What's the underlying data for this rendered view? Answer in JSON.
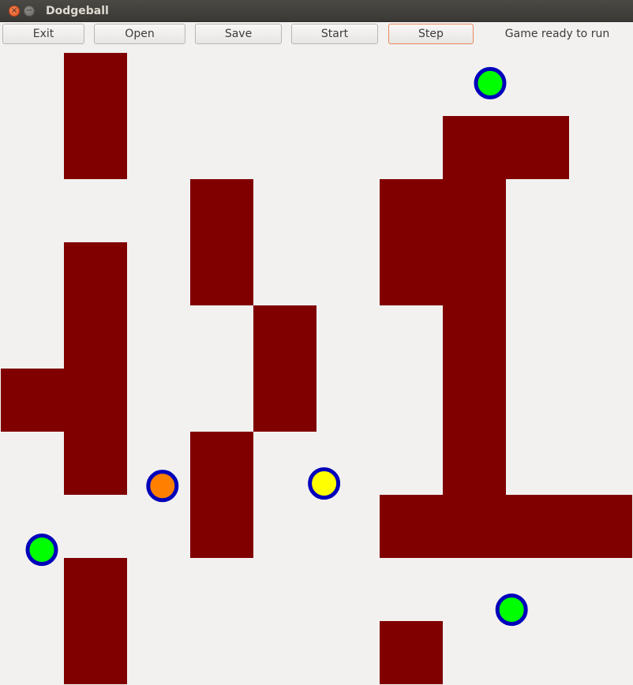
{
  "window": {
    "title": "Dodgeball"
  },
  "toolbar": {
    "buttons": [
      {
        "id": "exit",
        "label": "Exit"
      },
      {
        "id": "open",
        "label": "Open"
      },
      {
        "id": "save",
        "label": "Save"
      },
      {
        "id": "start",
        "label": "Start"
      },
      {
        "id": "step",
        "label": "Step"
      }
    ],
    "status": "Game ready to run"
  },
  "board": {
    "cell_colors": {
      "floor": "#f2f1f0",
      "wall": "#800000"
    },
    "walls": [
      [
        1,
        0
      ],
      [
        1,
        1
      ],
      [
        7,
        1
      ],
      [
        8,
        1
      ],
      [
        3,
        2
      ],
      [
        6,
        2
      ],
      [
        7,
        2
      ],
      [
        1,
        3
      ],
      [
        3,
        3
      ],
      [
        6,
        3
      ],
      [
        7,
        3
      ],
      [
        1,
        4
      ],
      [
        4,
        4
      ],
      [
        7,
        4
      ],
      [
        0,
        5
      ],
      [
        1,
        5
      ],
      [
        4,
        5
      ],
      [
        7,
        5
      ],
      [
        1,
        6
      ],
      [
        3,
        6
      ],
      [
        7,
        6
      ],
      [
        3,
        7
      ],
      [
        6,
        7
      ],
      [
        7,
        7
      ],
      [
        8,
        7
      ],
      [
        9,
        7
      ],
      [
        1,
        8
      ],
      [
        1,
        9
      ],
      [
        6,
        9
      ]
    ],
    "balls": [
      {
        "color": "#00ff00",
        "ring": "#0000bb",
        "col": 7.75,
        "row": 0.48
      },
      {
        "color": "#ff8000",
        "ring": "#0000bb",
        "col": 2.56,
        "row": 6.86
      },
      {
        "color": "#ffff00",
        "ring": "#0000bb",
        "col": 5.12,
        "row": 6.82
      },
      {
        "color": "#00ff00",
        "ring": "#0000bb",
        "col": 0.65,
        "row": 7.87
      },
      {
        "color": "#00ff00",
        "ring": "#0000bb",
        "col": 8.09,
        "row": 8.82
      }
    ]
  }
}
